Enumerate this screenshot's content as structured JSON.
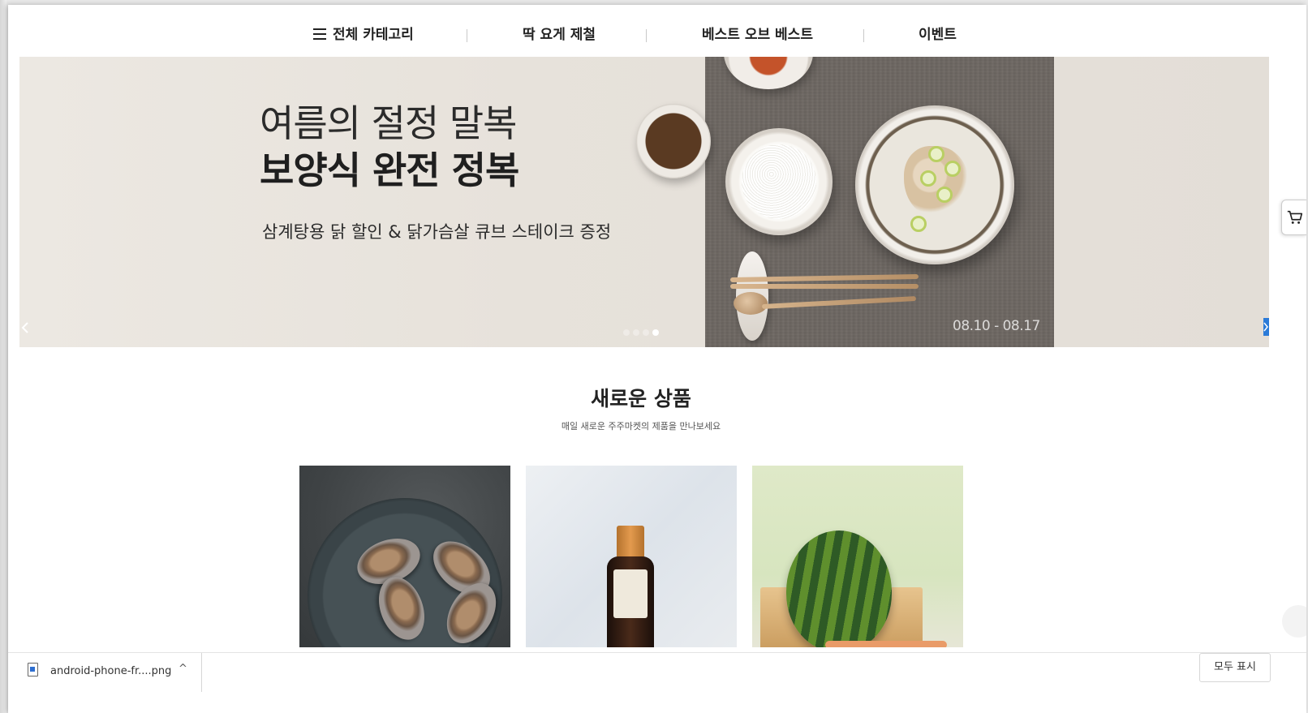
{
  "nav": {
    "items": [
      {
        "label": "전체 카테고리"
      },
      {
        "label": "딱 요게 제철"
      },
      {
        "label": "베스트 오브 베스트"
      },
      {
        "label": "이벤트"
      }
    ],
    "menu_icon": "hamburger-icon"
  },
  "banner": {
    "line1": "여름의 절정 말복",
    "line2": "보양식 완전 정복",
    "line3": "삼계탕용 닭 할인 & 닭가슴살 큐브 스테이크 증정",
    "date": "08.10 - 08.17",
    "slide_count": 4,
    "active_slide": 4,
    "prev_icon": "chevron-left-icon",
    "next_icon": "chevron-right-icon"
  },
  "cart": {
    "icon": "cart-icon"
  },
  "new_products": {
    "title": "새로운 상품",
    "subtitle": "매일 새로운 주주마켓의 제품을 만나보세요"
  },
  "download_bar": {
    "file_name": "android-phone-fr....png",
    "file_icon": "image-file-icon",
    "caret": "^",
    "show_all_label": "모두 표시"
  },
  "colors": {
    "accent_blue": "#2b7bd8",
    "banner_bg": "#e7e2db",
    "cloth": "#6e6863"
  }
}
